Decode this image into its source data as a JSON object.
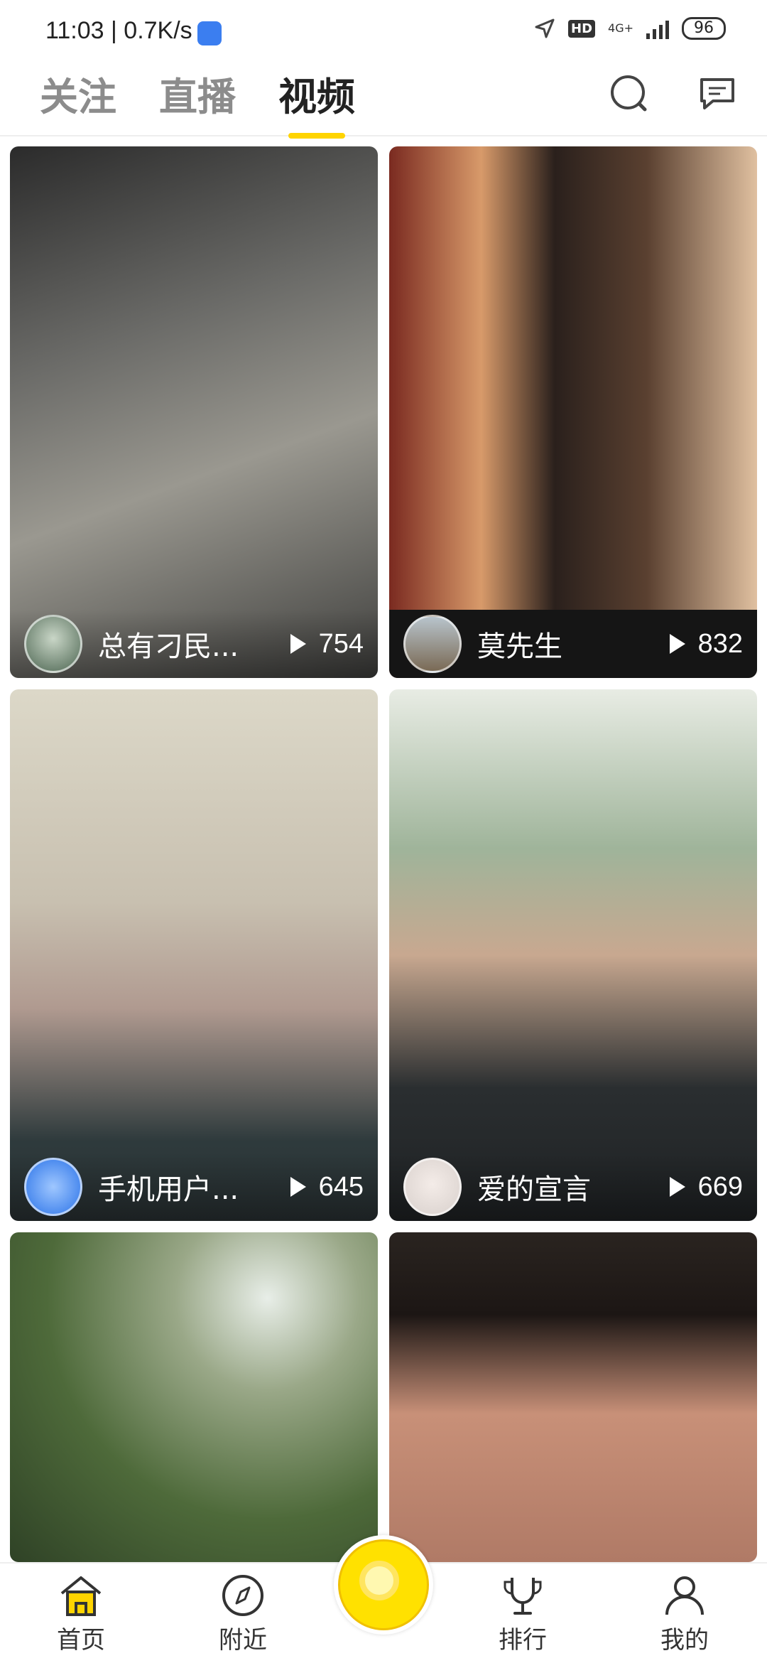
{
  "status_bar": {
    "time_speed": "11:03 | 0.7K/s",
    "hd": "HD",
    "network": "4G+",
    "battery": "96"
  },
  "top_tabs": [
    {
      "label": "关注",
      "active": false
    },
    {
      "label": "直播",
      "active": false
    },
    {
      "label": "视频",
      "active": true
    }
  ],
  "top_icons": [
    "search-icon",
    "message-icon"
  ],
  "videos": [
    {
      "name": "总有刁民...",
      "plays": "754",
      "thumb_color": "#5b5a59"
    },
    {
      "name": "莫先生",
      "plays": "832",
      "thumb_color": "#3a2a24"
    },
    {
      "name": "手机用户...",
      "plays": "645",
      "thumb_color": "#c9c4b8"
    },
    {
      "name": "爱的宣言",
      "plays": "669",
      "thumb_color": "#6e7a70"
    },
    {
      "name": "",
      "plays": "",
      "thumb_color": "#5e6e4a"
    },
    {
      "name": "",
      "plays": "",
      "thumb_color": "#8a5a4a"
    }
  ],
  "bottom_nav": [
    {
      "label": "首页",
      "icon": "home-icon",
      "active": true
    },
    {
      "label": "附近",
      "icon": "compass-icon",
      "active": false
    },
    {
      "label": "排行",
      "icon": "trophy-icon",
      "active": false
    },
    {
      "label": "我的",
      "icon": "profile-icon",
      "active": false
    }
  ],
  "colors": {
    "accent": "#ffd400"
  }
}
